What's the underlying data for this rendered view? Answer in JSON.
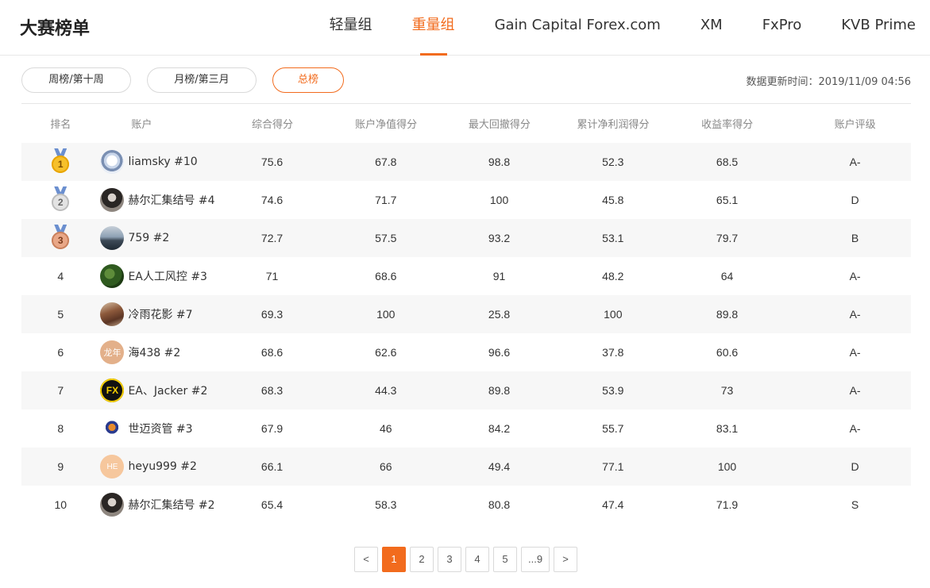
{
  "header": {
    "title": "大赛榜单",
    "tabs": [
      {
        "label": "轻量组",
        "active": false
      },
      {
        "label": "重量组",
        "active": true
      },
      {
        "label": "Gain Capital Forex.com",
        "active": false
      },
      {
        "label": "XM",
        "active": false
      },
      {
        "label": "FxPro",
        "active": false
      },
      {
        "label": "KVB Prime",
        "active": false
      }
    ]
  },
  "filters": [
    {
      "label": "周榜/第十周",
      "active": false
    },
    {
      "label": "月榜/第三月",
      "active": false
    },
    {
      "label": "总榜",
      "active": true
    }
  ],
  "update_time": "数据更新时间：2019/11/09 04:56",
  "accent_color": "#f26b1d",
  "table": {
    "columns": [
      "排名",
      "账户",
      "综合得分",
      "账户净值得分",
      "最大回撤得分",
      "累计净利润得分",
      "收益率得分",
      "账户评级"
    ],
    "rows": [
      {
        "rank": "1",
        "medal": "gold",
        "avatar_text": "",
        "account": "liamsky #10",
        "score": "75.6",
        "nav": "67.8",
        "drawdown": "98.8",
        "profit": "52.3",
        "return": "68.5",
        "grade": "A-"
      },
      {
        "rank": "2",
        "medal": "silver",
        "avatar_text": "",
        "account": "赫尔汇集结号 #4",
        "score": "74.6",
        "nav": "71.7",
        "drawdown": "100",
        "profit": "45.8",
        "return": "65.1",
        "grade": "D"
      },
      {
        "rank": "3",
        "medal": "bronze",
        "avatar_text": "",
        "account": "759 #2",
        "score": "72.7",
        "nav": "57.5",
        "drawdown": "93.2",
        "profit": "53.1",
        "return": "79.7",
        "grade": "B"
      },
      {
        "rank": "4",
        "medal": "",
        "avatar_text": "",
        "account": "EA人工风控 #3",
        "score": "71",
        "nav": "68.6",
        "drawdown": "91",
        "profit": "48.2",
        "return": "64",
        "grade": "A-"
      },
      {
        "rank": "5",
        "medal": "",
        "avatar_text": "",
        "account": "冷雨花影 #7",
        "score": "69.3",
        "nav": "100",
        "drawdown": "25.8",
        "profit": "100",
        "return": "89.8",
        "grade": "A-"
      },
      {
        "rank": "6",
        "medal": "",
        "avatar_text": "龙年",
        "account": "海438 #2",
        "score": "68.6",
        "nav": "62.6",
        "drawdown": "96.6",
        "profit": "37.8",
        "return": "60.6",
        "grade": "A-"
      },
      {
        "rank": "7",
        "medal": "",
        "avatar_text": "FX",
        "account": "EA、Jacker #2",
        "score": "68.3",
        "nav": "44.3",
        "drawdown": "89.8",
        "profit": "53.9",
        "return": "73",
        "grade": "A-"
      },
      {
        "rank": "8",
        "medal": "",
        "avatar_text": "",
        "account": "世迈资管 #3",
        "score": "67.9",
        "nav": "46",
        "drawdown": "84.2",
        "profit": "55.7",
        "return": "83.1",
        "grade": "A-"
      },
      {
        "rank": "9",
        "medal": "",
        "avatar_text": "HE",
        "account": "heyu999 #2",
        "score": "66.1",
        "nav": "66",
        "drawdown": "49.4",
        "profit": "77.1",
        "return": "100",
        "grade": "D"
      },
      {
        "rank": "10",
        "medal": "",
        "avatar_text": "",
        "account": "赫尔汇集结号 #2",
        "score": "65.4",
        "nav": "58.3",
        "drawdown": "80.8",
        "profit": "47.4",
        "return": "71.9",
        "grade": "S"
      }
    ]
  },
  "pagination": {
    "prev": "<",
    "pages": [
      "1",
      "2",
      "3",
      "4",
      "5",
      "...9"
    ],
    "current": "1",
    "next": ">"
  }
}
